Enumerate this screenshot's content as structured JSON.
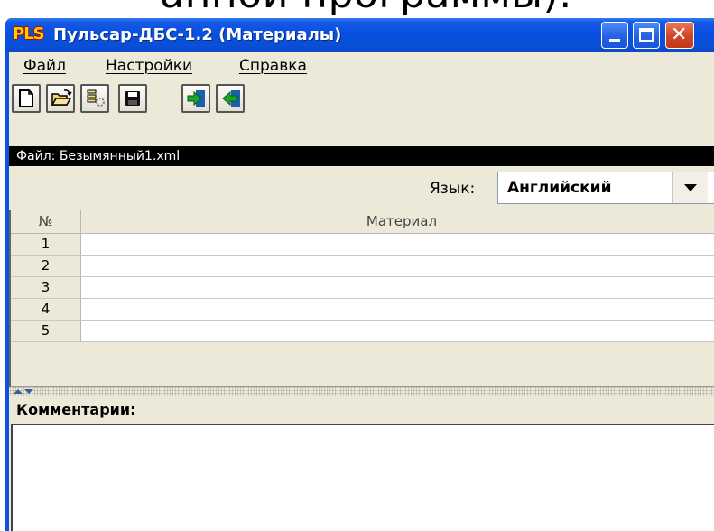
{
  "caption": "анной программы).",
  "window": {
    "app_logo": "PLS",
    "title": "Пульсар-ДБС-1.2 (Материалы)"
  },
  "menu": {
    "file": "Файл",
    "settings": "Настройки",
    "help": "Справка"
  },
  "toolbar": {
    "icons": [
      "new-document-icon",
      "open-folder-icon",
      "list-settings-icon",
      "save-floppy-icon",
      "import-green-arrow-icon",
      "export-green-arrow-icon"
    ]
  },
  "file_bar": {
    "text": "Файл: Безымянный1.xml"
  },
  "language": {
    "label": "Язык:",
    "selected": "Английский"
  },
  "table": {
    "columns": [
      "№",
      "Материал"
    ],
    "rows": [
      {
        "num": "1",
        "material": ""
      },
      {
        "num": "2",
        "material": ""
      },
      {
        "num": "3",
        "material": ""
      },
      {
        "num": "4",
        "material": ""
      },
      {
        "num": "5",
        "material": ""
      }
    ]
  },
  "comments": {
    "label": "Комментарии:",
    "value": ""
  },
  "colors": {
    "titlebar": "#0a54e0",
    "client_bg": "#ece9d8",
    "file_bar_bg": "#000000",
    "close_button": "#d2472a"
  }
}
